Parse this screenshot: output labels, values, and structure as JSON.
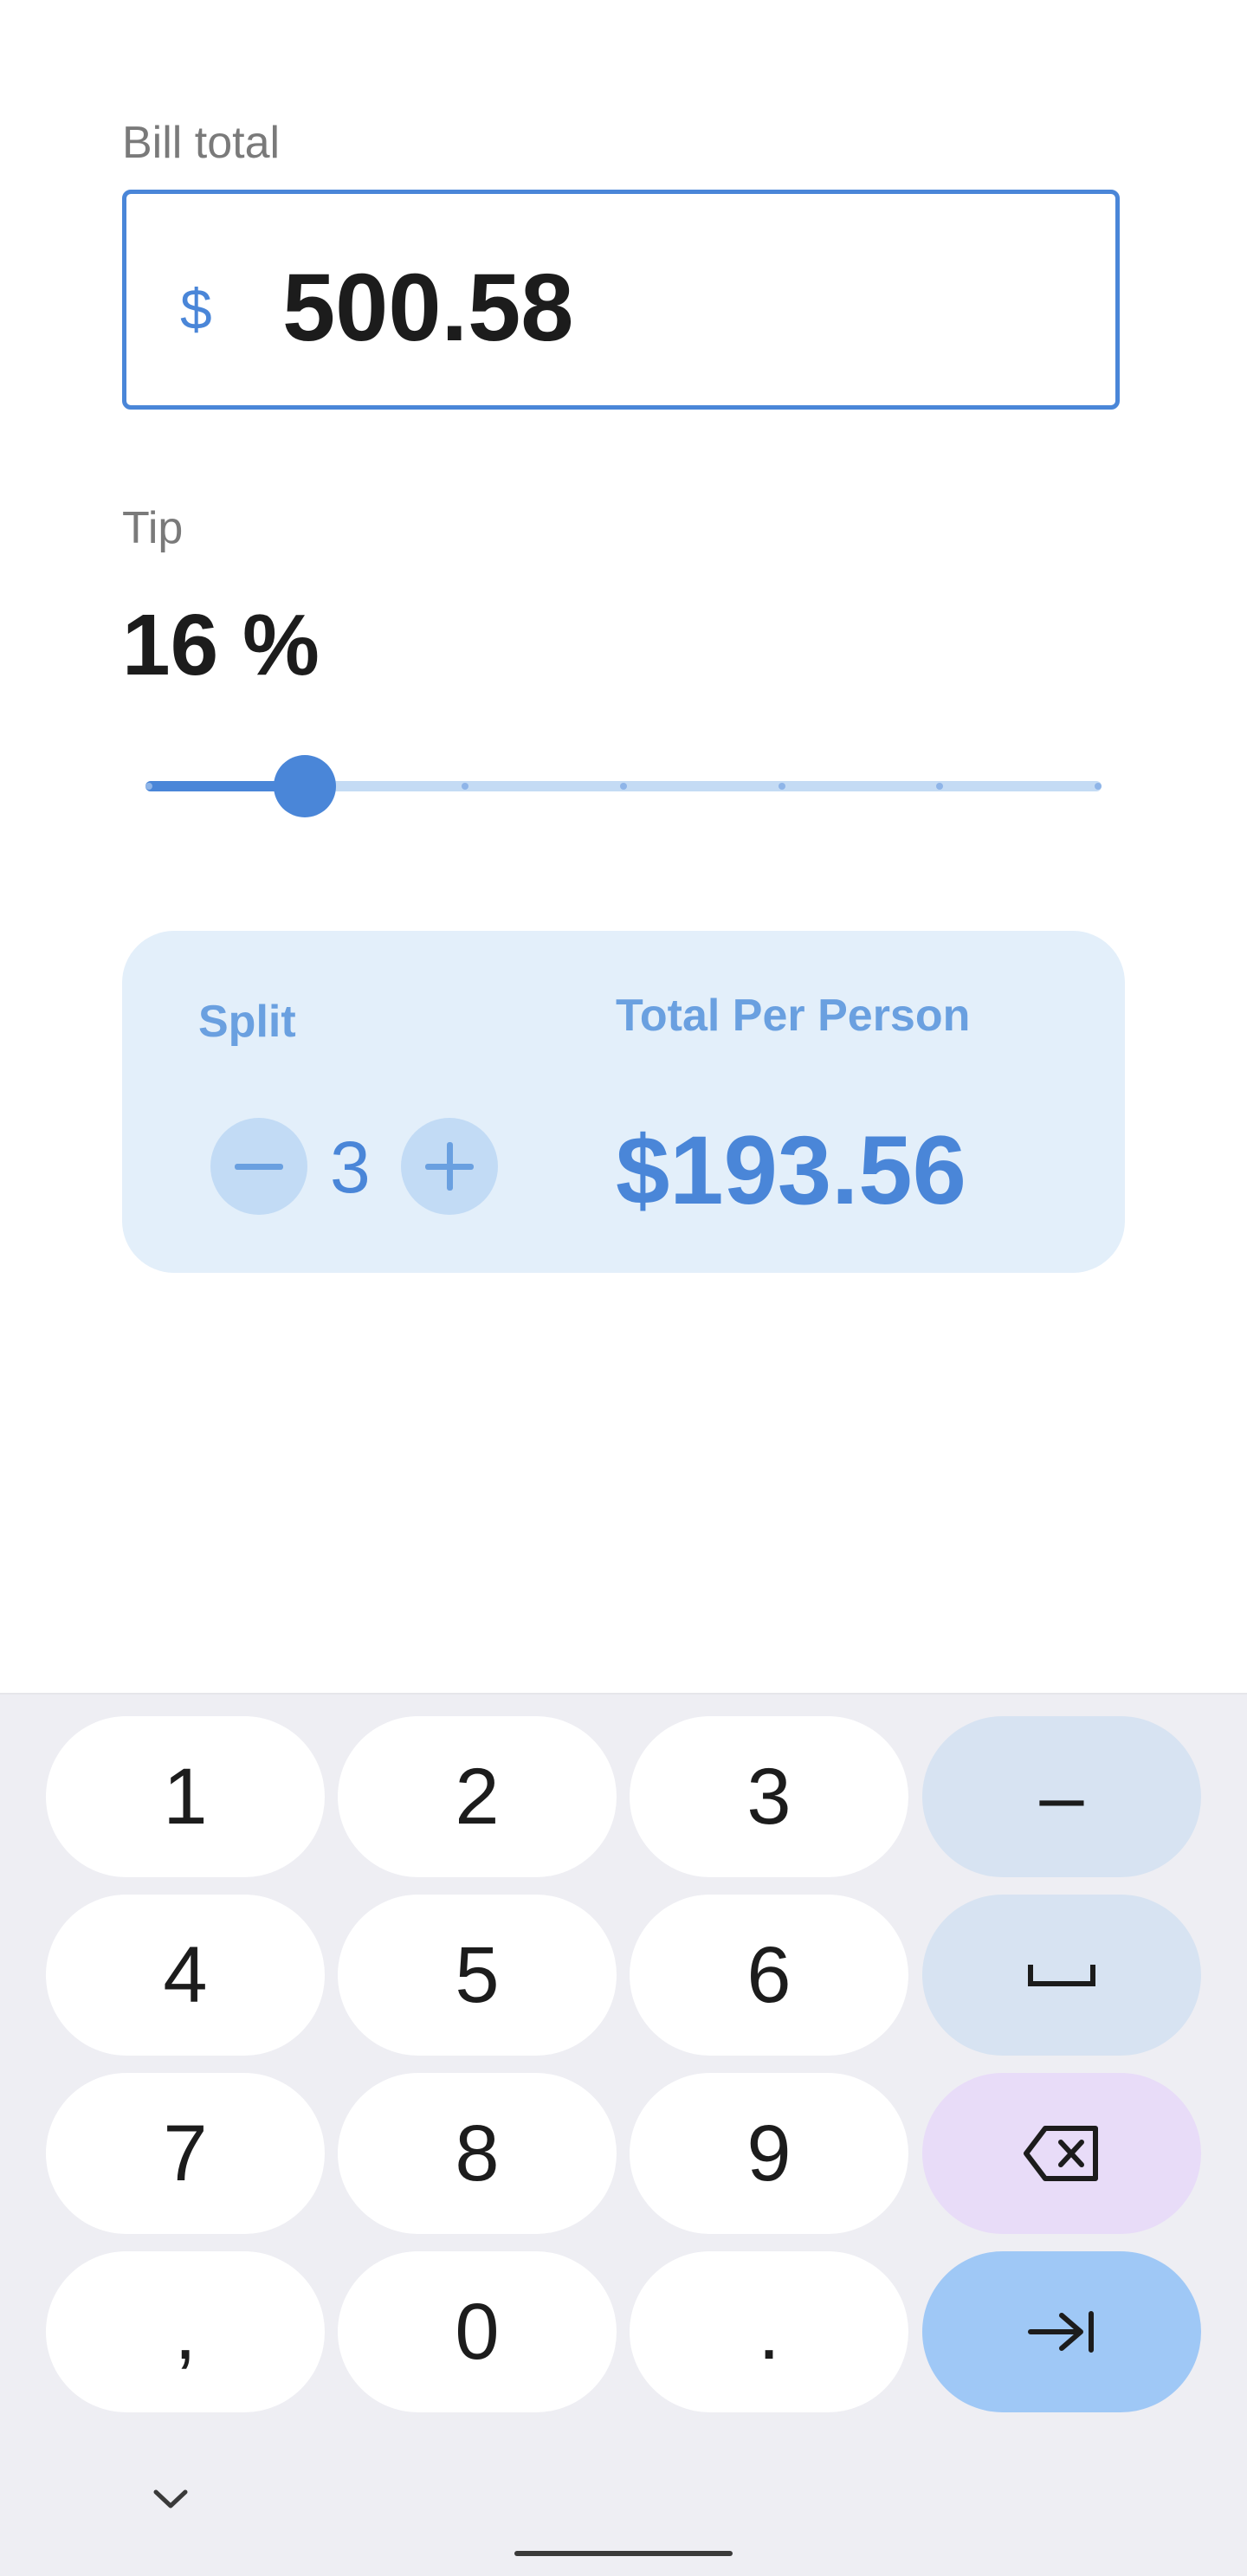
{
  "bill": {
    "label": "Bill total",
    "currency_symbol": "$",
    "value": "500.58"
  },
  "tip": {
    "label": "Tip",
    "value_text": "16 %",
    "slider_fraction": 0.167,
    "slider_ticks": 7
  },
  "split_card": {
    "split_label": "Split",
    "split_count": "3",
    "total_label": "Total Per Person",
    "total_value": "$193.56"
  },
  "keyboard": {
    "rows": [
      [
        "1",
        "2",
        "3",
        "–"
      ],
      [
        "4",
        "5",
        "6",
        "space-icon"
      ],
      [
        "7",
        "8",
        "9",
        "backspace-icon"
      ],
      [
        ",",
        "0",
        ".",
        "tab-next-icon"
      ]
    ]
  },
  "colors": {
    "accent": "#4a86d8",
    "card_bg": "#e3effa",
    "keyboard_bg": "#eeeef3"
  }
}
